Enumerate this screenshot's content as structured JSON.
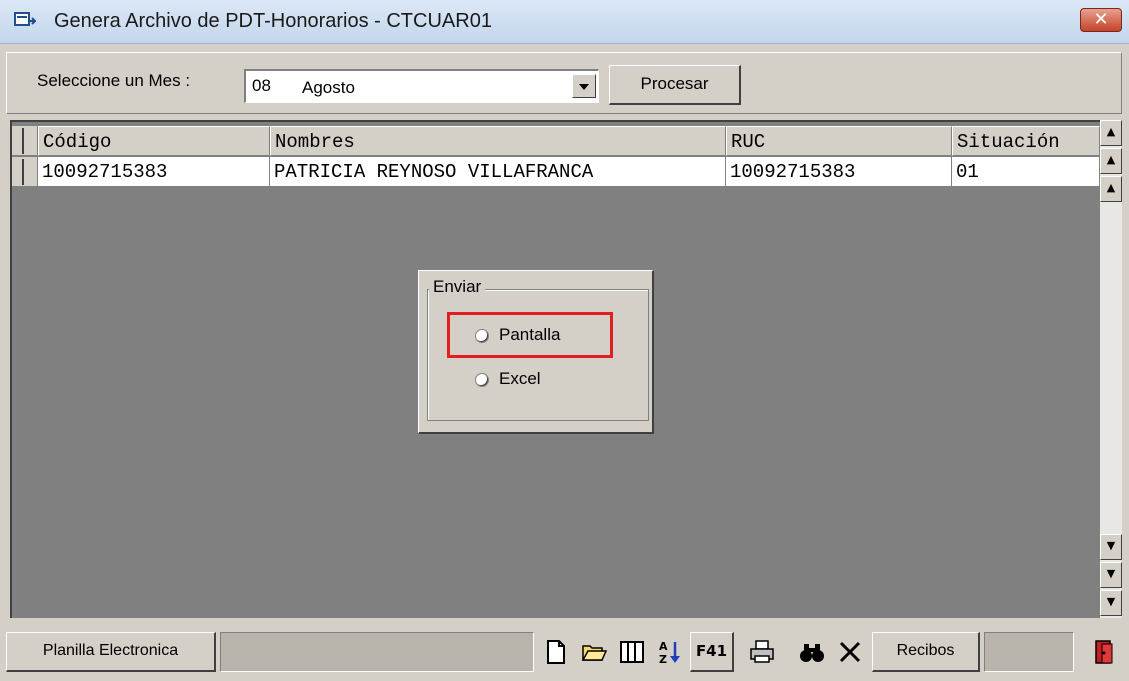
{
  "window": {
    "title": "Genera Archivo de PDT-Honorarios - CTCUAR01",
    "close_label": "✕"
  },
  "toolbar": {
    "mes_label": "Seleccione un Mes :",
    "mes_value_num": "08",
    "mes_value_name": "Agosto",
    "procesar_label": "Procesar"
  },
  "grid": {
    "columns": [
      "Código",
      "Nombres",
      "RUC",
      "Situación"
    ],
    "rows": [
      [
        "10092715383",
        "PATRICIA REYNOSO VILLAFRANCA",
        "10092715383",
        "01"
      ]
    ]
  },
  "enviar": {
    "title": "Enviar",
    "options": [
      "Pantalla",
      "Excel"
    ]
  },
  "bottom": {
    "planilla_label": "Planilla Electronica",
    "f41_label": "F41",
    "recibos_label": "Recibos"
  },
  "colors": {
    "grid_bg": "#808080",
    "face": "#d4d0c8",
    "highlight": "#e02020"
  }
}
